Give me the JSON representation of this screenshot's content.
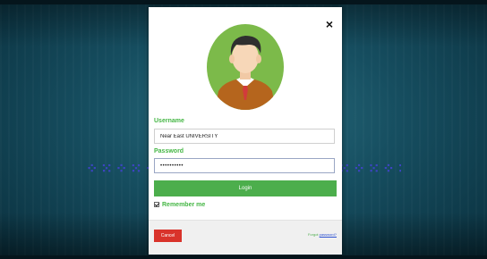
{
  "modal": {
    "close_icon": "×",
    "avatar_icon": "user-avatar-icon",
    "username_label": "Username",
    "username_value": "Near East UNIVERSITY",
    "password_label": "Password",
    "password_value": "••••••••••",
    "login_label": "Login",
    "remember_label": "Remember me",
    "remember_checked": true,
    "cancel_label": "Cancel",
    "forgot_prefix": "Forgot",
    "forgot_link": "password?"
  },
  "colors": {
    "accent": "#4cae4c",
    "cancel": "#d9332b",
    "avatar_bg": "#7cba4a"
  }
}
